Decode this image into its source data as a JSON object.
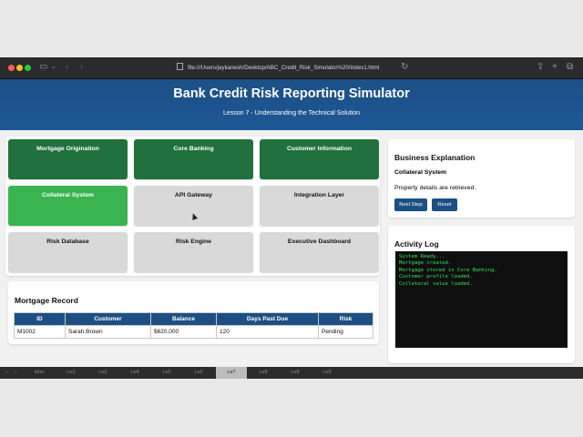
{
  "browser": {
    "url": "file:///Users/jaykanesh/Desktop/ABC_Credit_Risk_Simulator%20/index1.html"
  },
  "header": {
    "title": "Bank Credit Risk Reporting Simulator",
    "subtitle": "Lesson 7 - Understanding the Technical Solution"
  },
  "tiles": [
    {
      "label": "Mortgage Origination",
      "state": "complete"
    },
    {
      "label": "Core Banking",
      "state": "complete"
    },
    {
      "label": "Customer Information",
      "state": "complete"
    },
    {
      "label": "Collateral System",
      "state": "active"
    },
    {
      "label": "API Gateway",
      "state": "pending"
    },
    {
      "label": "Integration Layer",
      "state": "pending"
    },
    {
      "label": "Risk Database",
      "state": "pending"
    },
    {
      "label": "Risk Engine",
      "state": "pending"
    },
    {
      "label": "Executive Dashboard",
      "state": "pending"
    }
  ],
  "record": {
    "title": "Mortgage Record",
    "columns": [
      "ID",
      "Customer",
      "Balance",
      "Days Past Due",
      "Risk"
    ],
    "rows": [
      [
        "M1002",
        "Sarah Brown",
        "$620,000",
        "120",
        "Pending"
      ]
    ]
  },
  "explanation": {
    "title": "Business Explanation",
    "system": "Collateral System",
    "text": "Property details are retrieved.",
    "next_label": "Next Step",
    "reset_label": "Reset"
  },
  "activity": {
    "title": "Activity Log",
    "lines": [
      "System Ready...",
      "Mortgage created.",
      "Mortgage stored in Core Banking.",
      "Customer profile loaded.",
      "Collateral value loaded."
    ]
  },
  "tabstrip": {
    "tabs": [
      "Intro",
      "Le2",
      "Le2",
      "Le4",
      "Le5",
      "Le6",
      "Le7",
      "Le8",
      "Le8",
      "Le9"
    ],
    "active_index": 6
  },
  "colors": {
    "complete": "#20713d",
    "active": "#39b44e",
    "pending": "#d9d9d9",
    "header": "#1d4f84"
  }
}
